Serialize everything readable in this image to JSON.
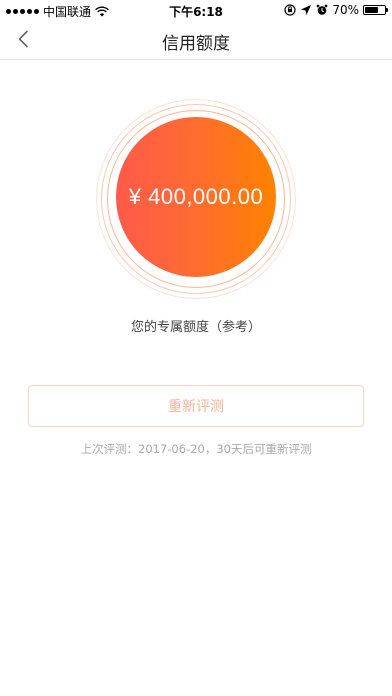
{
  "status_bar": {
    "carrier": "中国联通",
    "time": "下午6:18",
    "battery_percent": "70%",
    "battery_level": 0.7
  },
  "nav": {
    "title": "信用额度"
  },
  "credit": {
    "amount": "¥ 400,000.00",
    "label": "您的专属额度（参考）"
  },
  "action": {
    "re_evaluate_label": "重新评测"
  },
  "note": {
    "last_evaluation": "上次评测：2017-06-20，30天后可重新评测"
  },
  "colors": {
    "accent_start": "#ff5a4a",
    "accent_end": "#ff8200",
    "button_text": "#f9b39c",
    "button_border": "#fcd2c2"
  }
}
